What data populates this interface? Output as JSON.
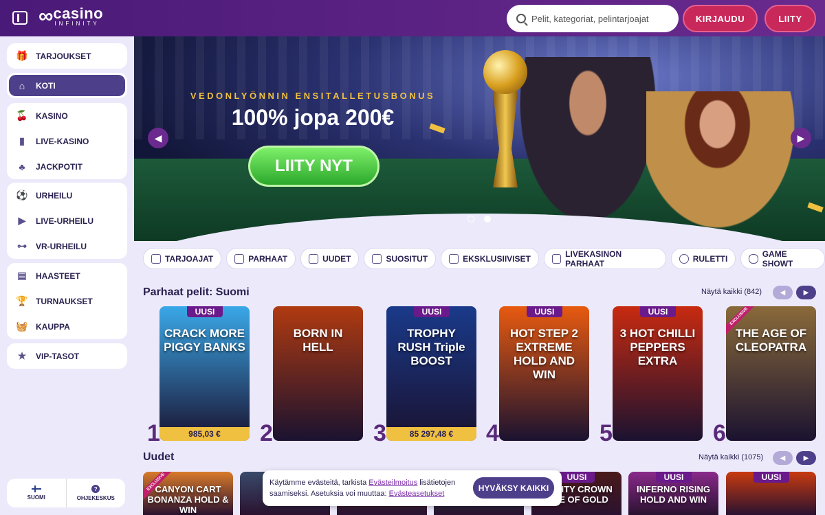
{
  "header": {
    "logo_word": "casino",
    "logo_sub": "INFINITY",
    "search_placeholder": "Pelit, kategoriat, pelintarjoajat",
    "login_label": "KIRJAUDU",
    "join_label": "LIITY"
  },
  "sidebar": {
    "groups": [
      [
        {
          "label": "TARJOUKSET",
          "icon": "gift-icon"
        }
      ],
      [
        {
          "label": "KOTI",
          "icon": "home-icon",
          "active": true
        }
      ],
      [
        {
          "label": "KASINO",
          "icon": "cherry-icon"
        },
        {
          "label": "LIVE-KASINO",
          "icon": "card-icon"
        },
        {
          "label": "JACKPOTIT",
          "icon": "clover-icon"
        }
      ],
      [
        {
          "label": "URHEILU",
          "icon": "soccer-ball-icon"
        },
        {
          "label": "LIVE-URHEILU",
          "icon": "play-icon"
        },
        {
          "label": "VR-URHEILU",
          "icon": "vr-icon"
        }
      ],
      [
        {
          "label": "HAASTEET",
          "icon": "chest-icon"
        },
        {
          "label": "TURNAUKSET",
          "icon": "trophy-icon"
        },
        {
          "label": "KAUPPA",
          "icon": "basket-icon"
        }
      ],
      [
        {
          "label": "VIP-TASOT",
          "icon": "star-icon"
        }
      ]
    ],
    "footer": {
      "language": "SUOMI",
      "help": "OHJEKESKUS"
    }
  },
  "hero": {
    "kicker": "VEDONLYÖNNIN ENSITALLETUSBONUS",
    "title": "100% jopa 200€",
    "cta": "LIITY NYT",
    "slides_total": 2,
    "active_slide": 2
  },
  "categories": [
    {
      "label": "TARJOAJAT",
      "icon": "provider-icon"
    },
    {
      "label": "PARHAAT",
      "icon": "crown-icon"
    },
    {
      "label": "UUDET",
      "icon": "lightning-icon"
    },
    {
      "label": "SUOSITUT",
      "icon": "flame-icon"
    },
    {
      "label": "EKSKLUSIIVISET",
      "icon": "diamond-icon"
    },
    {
      "label": "LIVEKASINON PARHAAT",
      "icon": "star-icon"
    },
    {
      "label": "RULETTI",
      "icon": "roulette-icon"
    },
    {
      "label": "GAME SHOWT",
      "icon": "microphone-icon"
    }
  ],
  "top_games": {
    "title": "Parhaat pelit: Suomi",
    "see_all": "Näytä kaikki (842)",
    "new_badge": "UUSI",
    "exclusive_badge": "EXCLUSIVE",
    "games": [
      {
        "rank": "1",
        "name": "CRACK MORE PIGGY BANKS",
        "new": true,
        "jackpot": "985,03 €",
        "bg": "#3aa8e8"
      },
      {
        "rank": "2",
        "name": "BORN IN HELL",
        "new": false,
        "jackpot": "",
        "bg": "#b03a10"
      },
      {
        "rank": "3",
        "name": "TROPHY RUSH Triple BOOST",
        "new": true,
        "jackpot": "85 297,48 €",
        "bg": "#1a3a8a"
      },
      {
        "rank": "4",
        "name": "HOT STEP 2 EXTREME HOLD AND WIN",
        "new": true,
        "jackpot": "",
        "bg": "#e85a10"
      },
      {
        "rank": "5",
        "name": "3 HOT CHILLI PEPPERS EXTRA",
        "new": true,
        "jackpot": "",
        "bg": "#c82a10"
      },
      {
        "rank": "6",
        "name": "THE AGE OF CLEOPATRA",
        "new": false,
        "exclusive": true,
        "jackpot": "",
        "bg": "#8a6a3a"
      }
    ]
  },
  "new_games": {
    "title": "Uudet",
    "see_all": "Näytä kaikki (1075)",
    "games": [
      {
        "name": "CANYON CART BONANZA HOLD & WIN",
        "new": false,
        "exclusive": true,
        "bg": "#d87a2a"
      },
      {
        "name": "",
        "new": false,
        "bg": "#3a4a6a"
      },
      {
        "name": "",
        "new": false,
        "bg": "#5a3a2a"
      },
      {
        "name": "",
        "new": false,
        "bg": "#2a5a4a"
      },
      {
        "name": "MIGHTY CROWN FIRE OF GOLD",
        "new": true,
        "bg": "#4a1a1a"
      },
      {
        "name": "INFERNO RISING HOLD AND WIN",
        "new": true,
        "bg": "#8a2a8a"
      },
      {
        "name": "",
        "new": true,
        "bg": "#c83a10"
      }
    ]
  },
  "cookie": {
    "text_before": "Käytämme evästeitä, tarkista ",
    "link1": "Evästeilmoitus",
    "text_mid": " lisätietojen saamiseksi. Asetuksia voi muuttaa: ",
    "link2": "Evästeasetukset",
    "accept": "HYVÄKSY KAIKKI"
  },
  "colors": {
    "brand": "#5a2282",
    "accent": "#c8285a",
    "cta_green": "#2ca82c",
    "gold": "#f0c040"
  }
}
